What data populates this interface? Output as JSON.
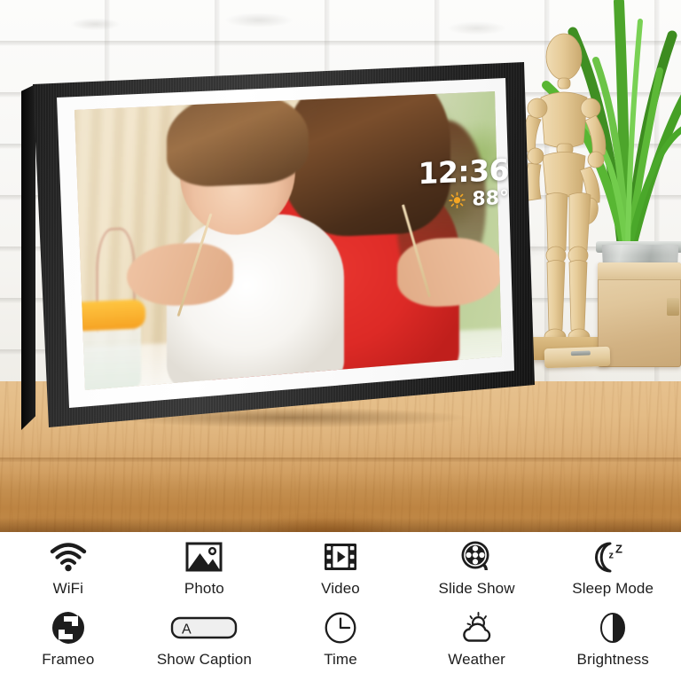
{
  "device_display": {
    "clock": "12:36",
    "temperature": "88°",
    "weather_icon": "sun-icon"
  },
  "scene": {
    "wall": "white-painted-brick-wall",
    "surface": "wooden-table",
    "props": [
      "wooden-artist-mannequin",
      "potted-grass-plant",
      "wooden-crate",
      "clothespin"
    ],
    "photo_subject": "mother-and-toddler-painting"
  },
  "colors": {
    "frame": "#242424",
    "mat": "#ffffff",
    "icon": "#1d1d1d",
    "panel_bg": "#ffffff",
    "sun": "#f5a623",
    "table": "#d9ae72",
    "wall": "#f7f6f3"
  },
  "legend": {
    "rows": [
      [
        {
          "label": "WiFi",
          "icon": "wifi-icon"
        },
        {
          "label": "Photo",
          "icon": "photo-icon"
        },
        {
          "label": "Video",
          "icon": "video-icon"
        },
        {
          "label": "Slide Show",
          "icon": "film-reel-icon"
        },
        {
          "label": "Sleep Mode",
          "icon": "moon-zzz-icon"
        }
      ],
      [
        {
          "label": "Frameo",
          "icon": "frameo-logo-icon"
        },
        {
          "label": "Show Caption",
          "icon": "caption-a-icon"
        },
        {
          "label": "Time",
          "icon": "clock-icon"
        },
        {
          "label": "Weather",
          "icon": "sun-cloud-icon"
        },
        {
          "label": "Brightness",
          "icon": "brightness-half-circle-icon"
        }
      ]
    ]
  }
}
